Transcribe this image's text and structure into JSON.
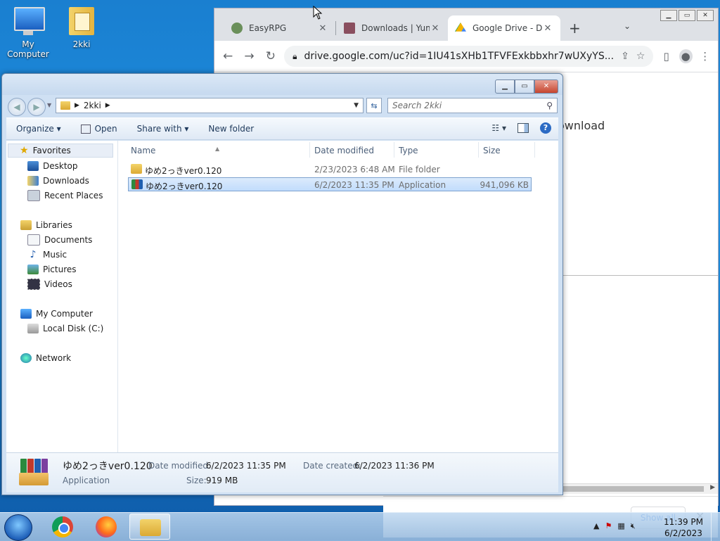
{
  "desktop": {
    "icons": [
      {
        "label": "My Computer"
      },
      {
        "label": "2kki"
      }
    ]
  },
  "browser": {
    "tabs": [
      {
        "label": "EasyRPG",
        "close": "✕"
      },
      {
        "label": "Downloads | Yum",
        "close": "✕"
      },
      {
        "label": "Google Drive - Do",
        "close": "✕"
      }
    ],
    "new_tab": "+",
    "url": "drive.google.com/uc?id=1IU41sXHb1TFVFExkbbxhr7wUXyYS...",
    "content_text": "ownload",
    "download_bar": {
      "show_all": "Show all",
      "close": "✕"
    }
  },
  "explorer": {
    "breadcrumb": [
      "2kki"
    ],
    "search_placeholder": "Search 2kki",
    "commands": {
      "organize": "Organize ▾",
      "open": "Open",
      "share_with": "Share with ▾",
      "new_folder": "New folder"
    },
    "nav": {
      "favorites": "Favorites",
      "desktop": "Desktop",
      "downloads": "Downloads",
      "recent": "Recent Places",
      "libraries": "Libraries",
      "documents": "Documents",
      "music": "Music",
      "pictures": "Pictures",
      "videos": "Videos",
      "my_computer": "My Computer",
      "local_disk": "Local Disk (C:)",
      "network": "Network"
    },
    "columns": {
      "name": "Name",
      "date": "Date modified",
      "type": "Type",
      "size": "Size"
    },
    "files": [
      {
        "name": "ゆめ2っきver0.120",
        "date": "2/23/2023 6:48 AM",
        "type": "File folder",
        "size": ""
      },
      {
        "name": "ゆめ2っきver0.120",
        "date": "6/2/2023 11:35 PM",
        "type": "Application",
        "size": "941,096 KB"
      }
    ],
    "details": {
      "name": "ゆめ2っきver0.120",
      "type": "Application",
      "modified_label": "Date modified:",
      "modified_value": "6/2/2023 11:35 PM",
      "created_label": "Date created:",
      "created_value": "6/2/2023 11:36 PM",
      "size_label": "Size:",
      "size_value": "919 MB"
    }
  },
  "taskbar": {
    "clock_time": "11:39 PM",
    "clock_date": "6/2/2023"
  },
  "colors": {
    "selection": "#c1dcfc",
    "chrome_tabbar": "#dee1e6",
    "link_blue": "#1a73e8"
  }
}
